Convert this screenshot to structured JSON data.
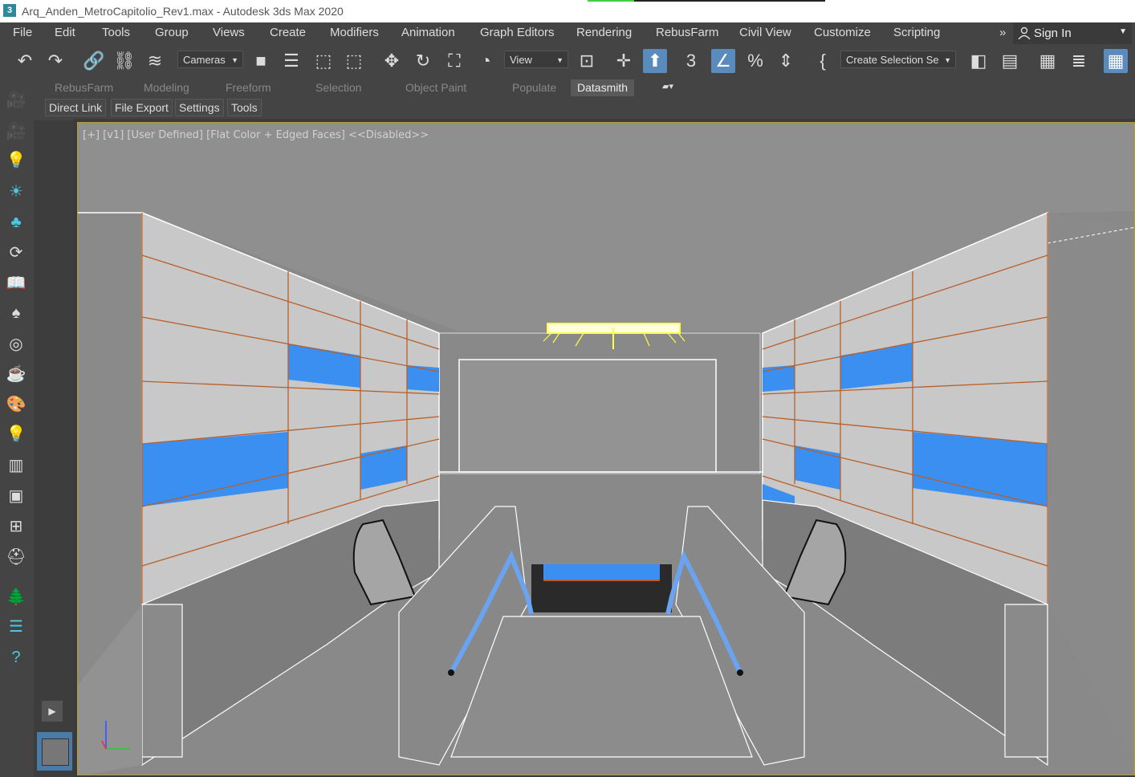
{
  "window": {
    "title": "Arq_Anden_MetroCapitolio_Rev1.max - Autodesk 3ds Max 2020",
    "app_icon": "3"
  },
  "menu": [
    "File",
    "Edit",
    "Tools",
    "Group",
    "Views",
    "Create",
    "Modifiers",
    "Animation",
    "Graph Editors",
    "Rendering",
    "RebusFarm",
    "Civil View",
    "Customize",
    "Scripting"
  ],
  "menu_overflow": "»",
  "signin": {
    "label": "Sign In"
  },
  "toolbar": {
    "selection_filter": "Cameras",
    "reference_coord": "View",
    "named_selection": "Create Selection Se",
    "icons": [
      "undo-icon",
      "redo-icon",
      "link-icon",
      "unlink-icon",
      "bind-space-warp-icon",
      "select-object-icon",
      "select-by-name-icon",
      "rect-region-icon",
      "window-crossing-icon",
      "move-icon",
      "rotate-icon",
      "scale-icon",
      "place-icon",
      "use-pivot-icon",
      "snap-3d-icon",
      "angle-snap-icon",
      "percent-snap-icon",
      "spinner-snap-icon",
      "edit-named-sel-icon",
      "mirror-icon",
      "align-icon",
      "layer-explorer-icon",
      "toggle-ribbon-icon",
      "scene-explorer-icon"
    ]
  },
  "ribbon": {
    "tabs": [
      "RebusFarm",
      "Modeling",
      "Freeform",
      "Selection",
      "Object Paint",
      "Populate",
      "Datasmith"
    ],
    "active": "Datasmith"
  },
  "subribbon": [
    "Direct Link",
    "File Export",
    "Settings",
    "Tools"
  ],
  "viewport": {
    "label": "[+] [v1] [User Defined] [Flat Color + Edged Faces] <<Disabled>>"
  },
  "left_icons": [
    "camera-icon",
    "camera-icon",
    "light-icon",
    "sun-icon",
    "tree-icon",
    "rotate-view-icon",
    "book-icon",
    "tree-icon",
    "donut-icon",
    "teapot-icon",
    "palette-icon",
    "bulb-icon",
    "panel-icon",
    "panel-icon",
    "grid-icon",
    "hat-icon",
    "tree-icon",
    "list-icon",
    "help-icon"
  ],
  "colors": {
    "accent": "#5a8bbd",
    "wall_blue": "#3a8ff0",
    "orange_line": "#b85f28",
    "light_yellow": "#ffff40"
  }
}
